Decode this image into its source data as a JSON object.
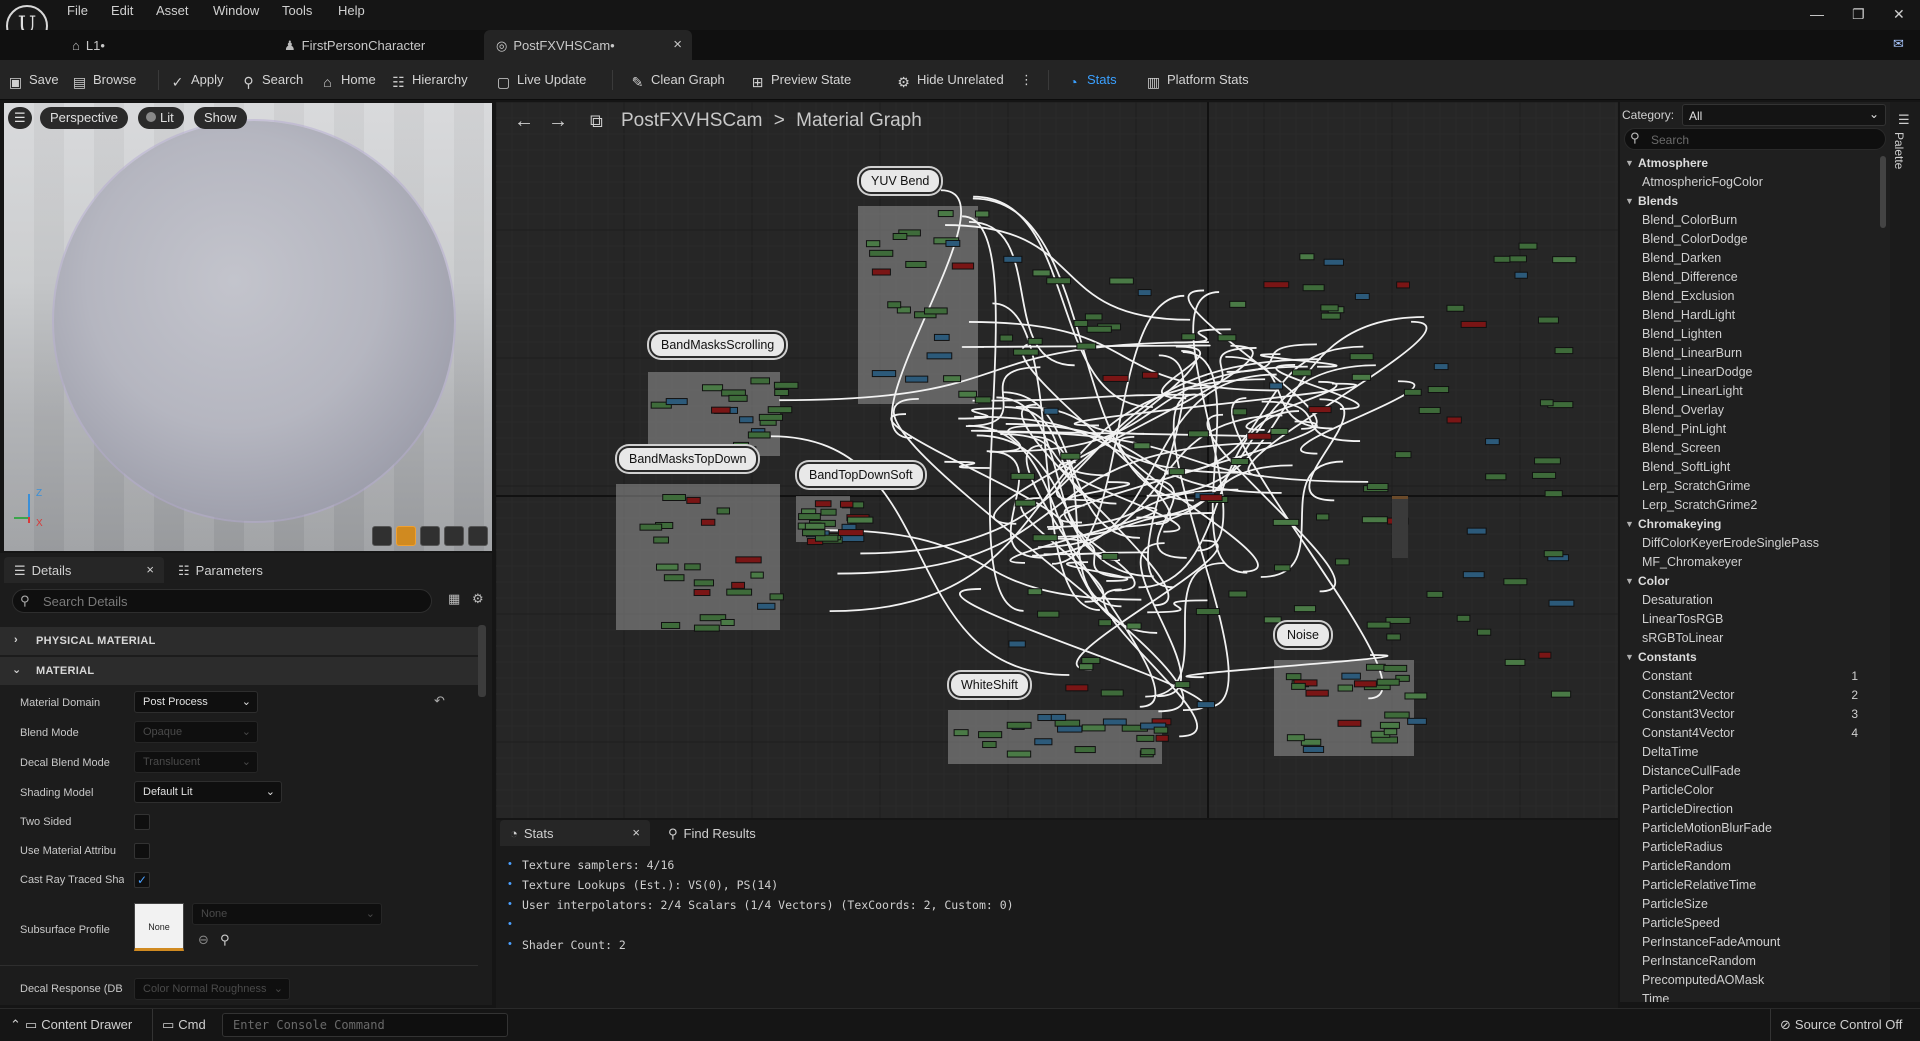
{
  "menus": [
    "File",
    "Edit",
    "Asset",
    "Window",
    "Tools",
    "Help"
  ],
  "window_controls": {
    "minimize": "—",
    "restore": "❐",
    "close": "✕"
  },
  "tabs": [
    {
      "label": "L1•"
    },
    {
      "label": "FirstPersonCharacter"
    },
    {
      "label": "PostFXVHSCam•",
      "close": "×"
    }
  ],
  "toolbar": {
    "save": "Save",
    "browse": "Browse",
    "apply": "Apply",
    "search": "Search",
    "home": "Home",
    "hierarchy": "Hierarchy",
    "live_update": "Live Update",
    "clean_graph": "Clean Graph",
    "preview_state": "Preview State",
    "hide_unrelated": "Hide Unrelated",
    "stats": "Stats",
    "platform_stats": "Platform Stats"
  },
  "viewport": {
    "perspective": "Perspective",
    "lit": "Lit",
    "show": "Show",
    "axis_z": "Z",
    "axis_x": "X"
  },
  "details": {
    "tab_details": "Details",
    "tab_details_close": "×",
    "tab_parameters": "Parameters",
    "search_placeholder": "Search Details",
    "section_physical": "PHYSICAL MATERIAL",
    "section_material": "MATERIAL",
    "material_domain_label": "Material Domain",
    "material_domain_value": "Post Process",
    "blend_mode_label": "Blend Mode",
    "blend_mode_value": "Opaque",
    "decal_blend_label": "Decal Blend Mode",
    "decal_blend_value": "Translucent",
    "shading_model_label": "Shading Model",
    "shading_model_value": "Default Lit",
    "two_sided_label": "Two Sided",
    "use_material_attr_label": "Use Material Attribu",
    "cast_ray_label": "Cast Ray Traced Sha",
    "subsurface_label": "Subsurface Profile",
    "subsurface_thumb": "None",
    "subsurface_value": "None",
    "decal_response_label": "Decal Response (DB",
    "decal_response_value": "Color Normal Roughness"
  },
  "graph": {
    "breadcrumb_asset": "PostFXVHSCam",
    "breadcrumb_sep": ">",
    "breadcrumb_graph": "Material Graph",
    "comments": [
      {
        "label": "YUV Bend"
      },
      {
        "label": "BandMasksScrolling"
      },
      {
        "label": "BandMasksTopDown"
      },
      {
        "label": "BandTopDownSoft"
      },
      {
        "label": "WhiteShift"
      },
      {
        "label": "Noise"
      }
    ]
  },
  "stats_panel": {
    "tab_stats": "Stats",
    "tab_stats_close": "×",
    "tab_find": "Find Results",
    "lines": [
      "Texture samplers: 4/16",
      "Texture Lookups (Est.): VS(0), PS(14)",
      "User interpolators: 2/4 Scalars (1/4 Vectors) (TexCoords: 2, Custom: 0)",
      "",
      "Shader Count: 2"
    ]
  },
  "palette": {
    "category_label": "Category:",
    "category_value": "All",
    "search_placeholder": "Search",
    "side_label": "Palette",
    "rows": [
      {
        "t": "c",
        "text": "Atmosphere"
      },
      {
        "t": "i",
        "text": "AtmosphericFogColor"
      },
      {
        "t": "c",
        "text": "Blends"
      },
      {
        "t": "i",
        "text": "Blend_ColorBurn"
      },
      {
        "t": "i",
        "text": "Blend_ColorDodge"
      },
      {
        "t": "i",
        "text": "Blend_Darken"
      },
      {
        "t": "i",
        "text": "Blend_Difference"
      },
      {
        "t": "i",
        "text": "Blend_Exclusion"
      },
      {
        "t": "i",
        "text": "Blend_HardLight"
      },
      {
        "t": "i",
        "text": "Blend_Lighten"
      },
      {
        "t": "i",
        "text": "Blend_LinearBurn"
      },
      {
        "t": "i",
        "text": "Blend_LinearDodge"
      },
      {
        "t": "i",
        "text": "Blend_LinearLight"
      },
      {
        "t": "i",
        "text": "Blend_Overlay"
      },
      {
        "t": "i",
        "text": "Blend_PinLight"
      },
      {
        "t": "i",
        "text": "Blend_Screen"
      },
      {
        "t": "i",
        "text": "Blend_SoftLight"
      },
      {
        "t": "i",
        "text": "Lerp_ScratchGrime"
      },
      {
        "t": "i",
        "text": "Lerp_ScratchGrime2"
      },
      {
        "t": "c",
        "text": "Chromakeying"
      },
      {
        "t": "i",
        "text": "DiffColorKeyerErodeSinglePass"
      },
      {
        "t": "i",
        "text": "MF_Chromakeyer"
      },
      {
        "t": "c",
        "text": "Color"
      },
      {
        "t": "i",
        "text": "Desaturation"
      },
      {
        "t": "i",
        "text": "LinearTosRGB"
      },
      {
        "t": "i",
        "text": "sRGBToLinear"
      },
      {
        "t": "c",
        "text": "Constants"
      },
      {
        "t": "i",
        "text": "Constant",
        "key": "1"
      },
      {
        "t": "i",
        "text": "Constant2Vector",
        "key": "2"
      },
      {
        "t": "i",
        "text": "Constant3Vector",
        "key": "3"
      },
      {
        "t": "i",
        "text": "Constant4Vector",
        "key": "4"
      },
      {
        "t": "i",
        "text": "DeltaTime"
      },
      {
        "t": "i",
        "text": "DistanceCullFade"
      },
      {
        "t": "i",
        "text": "ParticleColor"
      },
      {
        "t": "i",
        "text": "ParticleDirection"
      },
      {
        "t": "i",
        "text": "ParticleMotionBlurFade"
      },
      {
        "t": "i",
        "text": "ParticleRadius"
      },
      {
        "t": "i",
        "text": "ParticleRandom"
      },
      {
        "t": "i",
        "text": "ParticleRelativeTime"
      },
      {
        "t": "i",
        "text": "ParticleSize"
      },
      {
        "t": "i",
        "text": "ParticleSpeed"
      },
      {
        "t": "i",
        "text": "PerInstanceFadeAmount"
      },
      {
        "t": "i",
        "text": "PerInstanceRandom"
      },
      {
        "t": "i",
        "text": "PrecomputedAOMask"
      },
      {
        "t": "i",
        "text": "Time"
      }
    ]
  },
  "statusbar": {
    "content_drawer": "Content Drawer",
    "cmd": "Cmd",
    "console_placeholder": "Enter Console Command",
    "source_control": "Source Control Off"
  },
  "colors": {
    "accent": "#3aa0ff",
    "graph_bg": "#262626",
    "panel_bg": "#1c1c1c",
    "wire": "#ffffff",
    "node_green": "#3e6b3a",
    "node_red": "#7a1515",
    "node_blue": "#2c5a7a"
  }
}
